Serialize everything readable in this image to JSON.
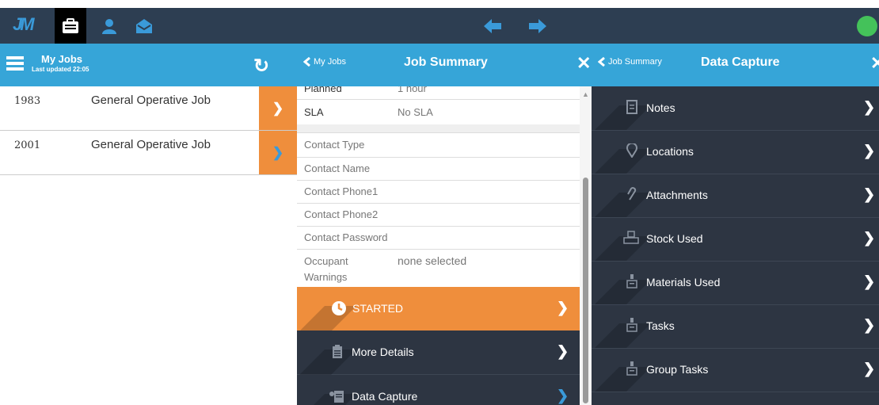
{
  "app": {
    "logo": "JM",
    "colors": {
      "topbar": "#2d3e52",
      "header": "#36a5d8",
      "accent": "#ef8e3c",
      "dark_panel": "#2d3542",
      "status_online": "#44c25a"
    }
  },
  "topnav": {
    "tabs": [
      {
        "icon": "briefcase-icon",
        "active": true
      },
      {
        "icon": "user-icon",
        "active": false
      },
      {
        "icon": "envelope-icon",
        "active": false
      }
    ],
    "back_icon": "arrow-left-icon",
    "forward_icon": "arrow-right-icon"
  },
  "jobs_panel": {
    "title": "My Jobs",
    "subtitle": "Last updated 22:05",
    "refresh_icon": "refresh-icon",
    "jobs": [
      {
        "number": "1983",
        "title": "General Operative Job"
      },
      {
        "number": "2001",
        "title": "General Operative Job"
      }
    ]
  },
  "summary_panel": {
    "back_label": "My Jobs",
    "title": "Job Summary",
    "rows": [
      {
        "label": "Planned",
        "value": "1 hour"
      },
      {
        "label": "SLA",
        "value": "No SLA"
      },
      {
        "label": "Contact Type",
        "value": ""
      },
      {
        "label": "Contact Name",
        "value": ""
      },
      {
        "label": "Contact Phone1",
        "value": ""
      },
      {
        "label": "Contact Phone2",
        "value": ""
      },
      {
        "label": "Contact Password",
        "value": ""
      },
      {
        "label": "Occupant\nWarnings",
        "value": "none selected"
      }
    ],
    "status_label": "STARTED",
    "more_details_label": "More Details",
    "data_capture_label": "Data Capture"
  },
  "capture_panel": {
    "back_label": "Job Summary",
    "title": "Data Capture",
    "items": [
      {
        "label": "Notes",
        "icon": "notes-icon"
      },
      {
        "label": "Locations",
        "icon": "location-pin-icon"
      },
      {
        "label": "Attachments",
        "icon": "paperclip-icon"
      },
      {
        "label": "Stock Used",
        "icon": "stock-icon"
      },
      {
        "label": "Materials Used",
        "icon": "materials-icon"
      },
      {
        "label": "Tasks",
        "icon": "tasks-icon"
      },
      {
        "label": "Group Tasks",
        "icon": "group-tasks-icon"
      }
    ]
  }
}
